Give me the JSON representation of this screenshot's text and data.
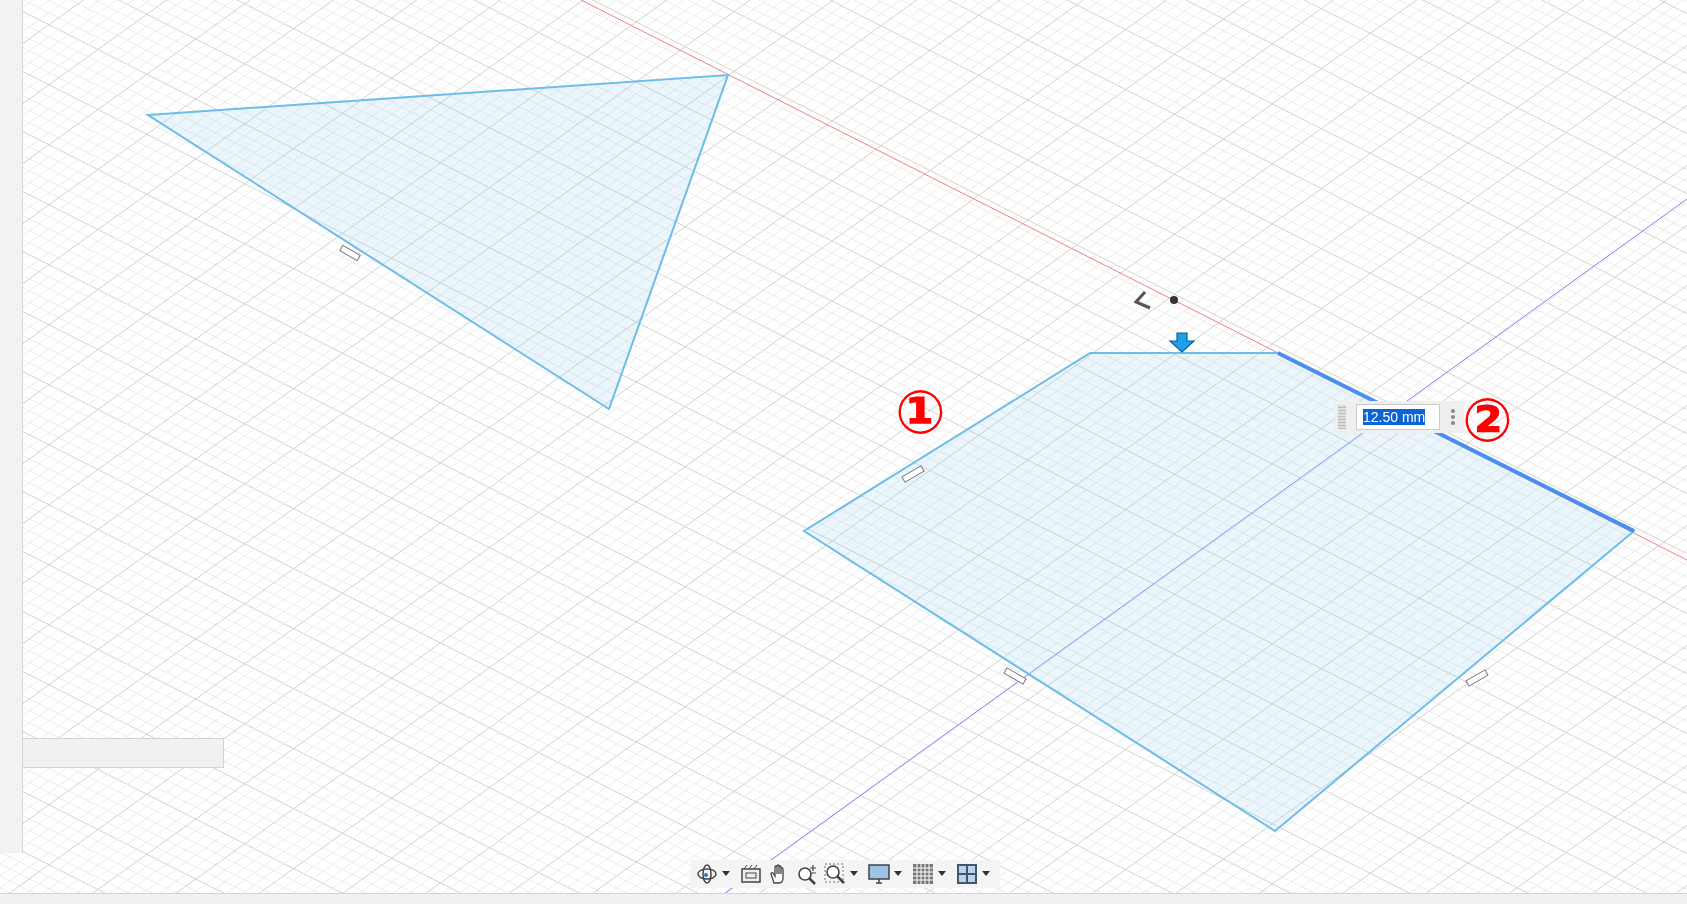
{
  "step_labels": [
    {
      "text": "①"
    },
    {
      "text": "②"
    }
  ],
  "dimension_input": {
    "value": "12.50 mm",
    "text_selected": true
  },
  "toolbar": {
    "items": [
      {
        "kind": "orbit",
        "dropdown": true
      },
      {
        "kind": "look",
        "dropdown": false
      },
      {
        "kind": "pan",
        "dropdown": false
      },
      {
        "kind": "zoom",
        "dropdown": false
      },
      {
        "kind": "fit",
        "dropdown": true
      },
      {
        "kind": "display",
        "dropdown": true
      },
      {
        "kind": "grid",
        "dropdown": true
      },
      {
        "kind": "viewports",
        "dropdown": true
      }
    ]
  }
}
